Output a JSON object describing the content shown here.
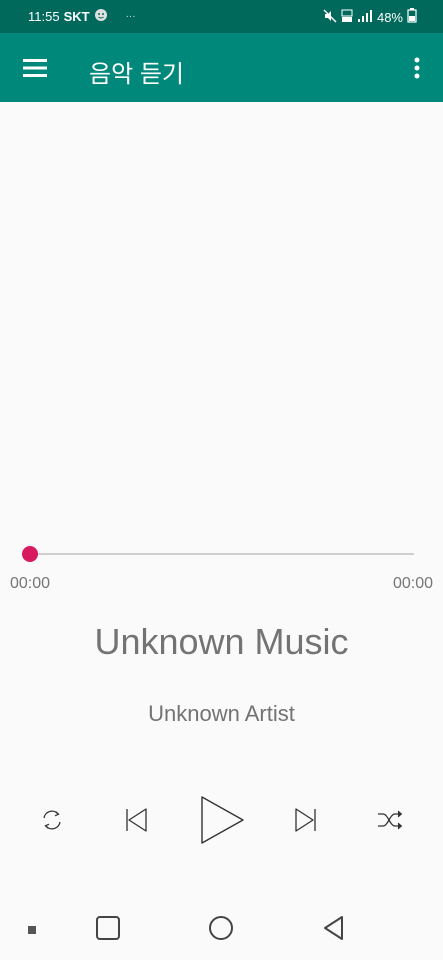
{
  "status_bar": {
    "time": "11:55",
    "carrier": "SKT",
    "notification_dots": "···",
    "battery_percent": "48%"
  },
  "app_bar": {
    "title": "음악 듣기"
  },
  "player": {
    "progress_fraction": 0,
    "current_time": "00:00",
    "total_time": "00:00",
    "track_title": "Unknown Music",
    "artist": "Unknown Artist"
  },
  "colors": {
    "status_bar": "#00695c",
    "app_bar": "#00897b",
    "accent": "#d81b60",
    "text_secondary": "#737373"
  },
  "icons": {
    "menu": "menu-icon",
    "more": "more-vert-icon",
    "repeat": "repeat-icon",
    "previous": "skip-previous-icon",
    "play": "play-icon",
    "next": "skip-next-icon",
    "shuffle": "shuffle-icon"
  }
}
